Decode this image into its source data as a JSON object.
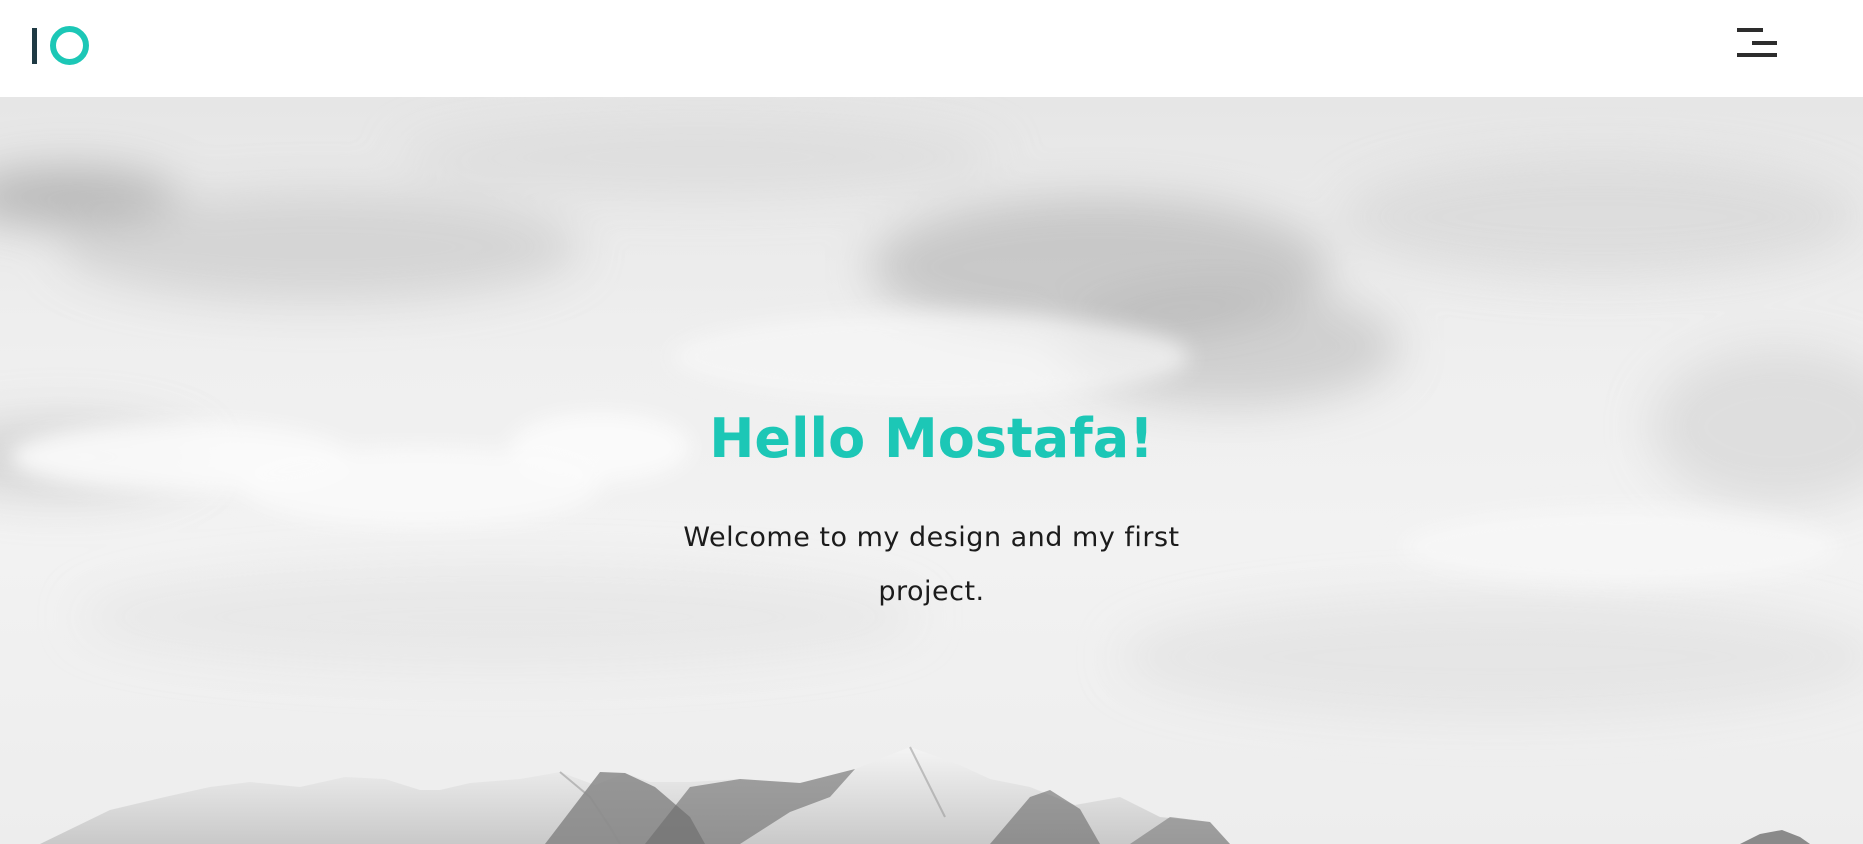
{
  "header": {
    "logo": {
      "icon": "io-logo-icon",
      "bar_color": "#1f3a44",
      "ring_color": "#1cc7b6"
    },
    "menu": {
      "icon": "hamburger-menu-icon"
    }
  },
  "hero": {
    "title": "Hello Mostafa!",
    "subtitle": "Welcome to my design and my first project.",
    "title_color": "#1cc7b6",
    "background": "grayscale-clouds-mountains"
  }
}
